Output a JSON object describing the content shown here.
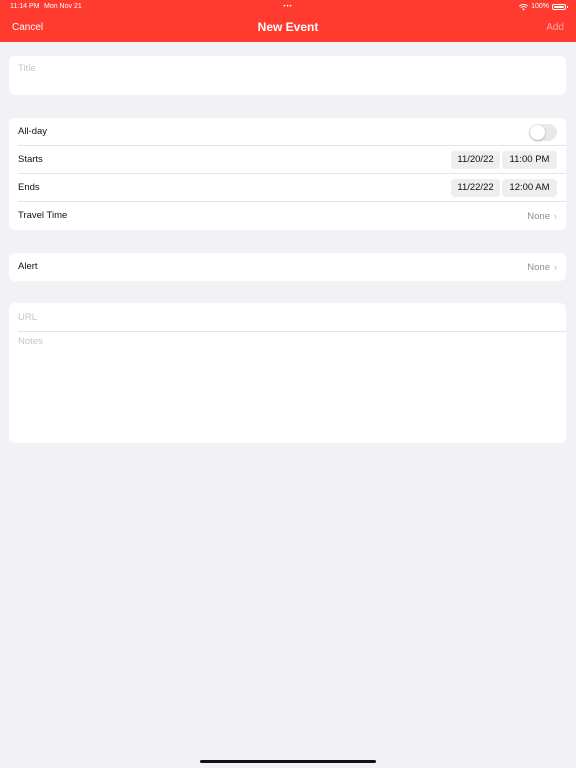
{
  "status_bar": {
    "time": "11:14 PM",
    "date": "Mon Nov 21",
    "battery": "100%"
  },
  "nav": {
    "cancel_label": "Cancel",
    "title": "New Event",
    "add_label": "Add"
  },
  "title_field": {
    "placeholder": "Title",
    "value": ""
  },
  "details": {
    "all_day_label": "All-day",
    "all_day_on": false,
    "starts_label": "Starts",
    "starts_date": "11/20/22",
    "starts_time": "11:00 PM",
    "ends_label": "Ends",
    "ends_date": "11/22/22",
    "ends_time": "12:00 AM",
    "travel_label": "Travel Time",
    "travel_value": "None"
  },
  "alert": {
    "label": "Alert",
    "value": "None"
  },
  "url_field": {
    "placeholder": "URL",
    "value": ""
  },
  "notes_field": {
    "placeholder": "Notes",
    "value": ""
  },
  "icons": {
    "wifi": "wifi-icon",
    "battery": "battery-icon",
    "chevron": "chevron-right-icon"
  },
  "colors": {
    "accent": "#FF3B30",
    "background": "#F2F1F6",
    "secondary_text": "#8E8E93"
  }
}
